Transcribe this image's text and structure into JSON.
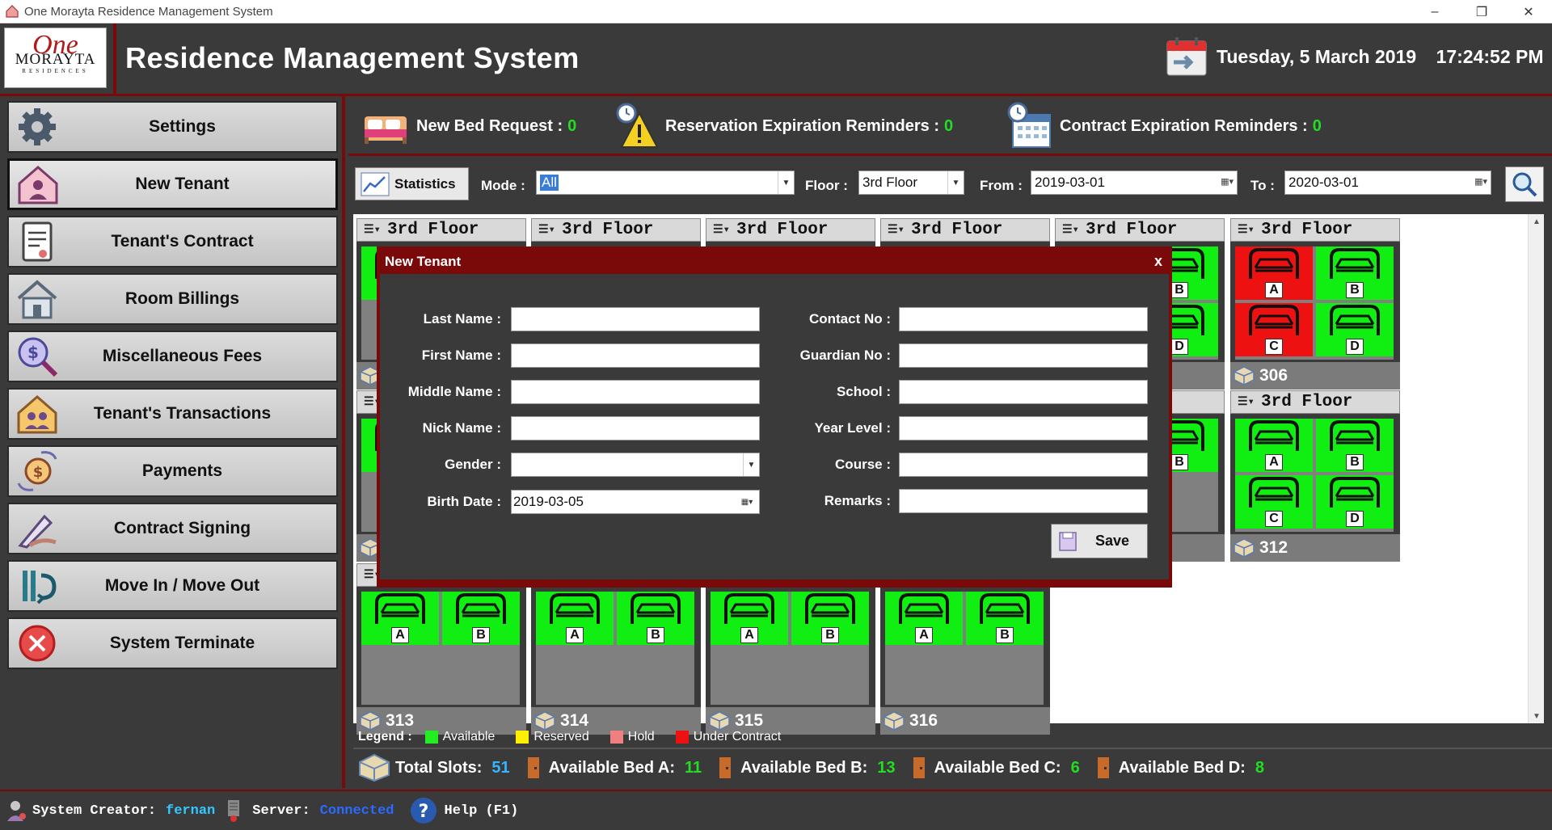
{
  "window": {
    "title": "One Morayta Residence Management System"
  },
  "header": {
    "logo_one": "One",
    "logo_morayta": "MORAYTA",
    "logo_residences": "RESIDENCES",
    "app_title": "Residence Management System",
    "date": "Tuesday, 5 March 2019",
    "time": "17:24:52 PM"
  },
  "sidebar": {
    "items": [
      {
        "label": "Settings",
        "icon": "gear-icon"
      },
      {
        "label": "New Tenant",
        "icon": "house-person-icon"
      },
      {
        "label": "Tenant's Contract",
        "icon": "document-icon"
      },
      {
        "label": "Room Billings",
        "icon": "house-icon"
      },
      {
        "label": "Miscellaneous Fees",
        "icon": "magnify-coin-icon"
      },
      {
        "label": "Tenant's Transactions",
        "icon": "house-people-icon"
      },
      {
        "label": "Payments",
        "icon": "money-exchange-icon"
      },
      {
        "label": "Contract Signing",
        "icon": "pen-hand-icon"
      },
      {
        "label": "Move In / Move Out",
        "icon": "move-icon"
      },
      {
        "label": "System Terminate",
        "icon": "close-circle-icon"
      }
    ]
  },
  "reminders": {
    "new_bed_label": "New Bed Request :",
    "new_bed_count": "0",
    "reservation_label": "Reservation Expiration Reminders :",
    "reservation_count": "0",
    "contract_label": "Contract Expiration Reminders :",
    "contract_count": "0"
  },
  "filters": {
    "statistics_label": "Statistics",
    "mode_label": "Mode :",
    "mode_value": "All",
    "floor_label": "Floor :",
    "floor_value": "3rd Floor",
    "from_label": "From :",
    "from_value": "2019-03-01",
    "to_label": "To :",
    "to_value": "2020-03-01"
  },
  "rooms": [
    {
      "floor": "3rd Floor",
      "number": ""
    },
    {
      "floor": "3rd Floor",
      "number": ""
    },
    {
      "floor": "3rd Floor",
      "number": ""
    },
    {
      "floor": "3rd Floor",
      "number": ""
    },
    {
      "floor": "3rd Floor",
      "number": ""
    },
    {
      "floor": "3rd Floor",
      "number": "306"
    },
    {
      "floor": "",
      "number": ""
    },
    {
      "floor": "or",
      "number": ""
    },
    {
      "floor": "3rd Floor",
      "number": "312"
    },
    {
      "floor": "",
      "number": "313"
    },
    {
      "floor": "",
      "number": "314"
    },
    {
      "floor": "",
      "number": "315"
    },
    {
      "floor": "",
      "number": "316"
    }
  ],
  "bed_letters": {
    "a": "A",
    "b": "B",
    "c": "C",
    "d": "D"
  },
  "legend": {
    "title": "Legend :",
    "available": "Available",
    "reserved": "Reserved",
    "hold": "Hold",
    "under_contract": "Under Contract",
    "colors": {
      "available": "#22ee22",
      "reserved": "#ffee00",
      "hold": "#f08080",
      "under_contract": "#ee1111"
    }
  },
  "totals": {
    "total_label": "Total Slots:",
    "total_value": "51",
    "bed_a_label": "Available Bed A:",
    "bed_a_value": "11",
    "bed_b_label": "Available Bed B:",
    "bed_b_value": "13",
    "bed_c_label": "Available Bed C:",
    "bed_c_value": "6",
    "bed_d_label": "Available Bed D:",
    "bed_d_value": "8"
  },
  "statusbar": {
    "creator_label": "System Creator:",
    "creator_value": "fernan",
    "server_label": "Server:",
    "server_value": "Connected",
    "help_label": "Help (F1)"
  },
  "modal": {
    "title": "New Tenant",
    "close": "x",
    "last_name_label": "Last Name :",
    "first_name_label": "First Name :",
    "middle_name_label": "Middle Name :",
    "nick_name_label": "Nick Name :",
    "gender_label": "Gender :",
    "birth_date_label": "Birth Date :",
    "birth_date_value": "2019-03-05",
    "contact_label": "Contact No :",
    "guardian_label": "Guardian No :",
    "school_label": "School :",
    "year_level_label": "Year Level :",
    "course_label": "Course :",
    "remarks_label": "Remarks :",
    "save_label": "Save"
  }
}
